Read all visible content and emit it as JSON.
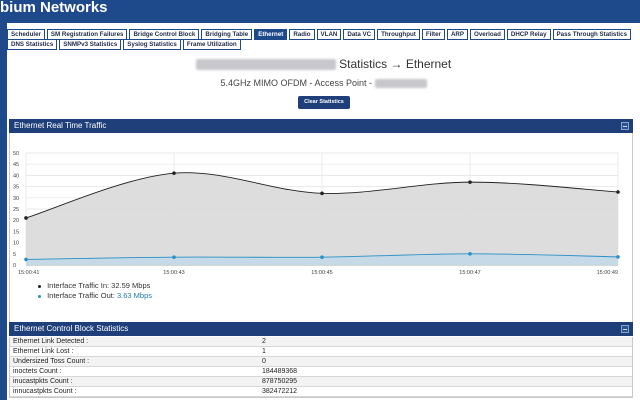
{
  "header": {
    "brand": "bium Networks"
  },
  "tabs_row1": [
    {
      "label": "Scheduler",
      "active": false
    },
    {
      "label": "SM Registration Failures",
      "active": false
    },
    {
      "label": "Bridge Control Block",
      "active": false
    },
    {
      "label": "Bridging Table",
      "active": false
    },
    {
      "label": "Ethernet",
      "active": true
    },
    {
      "label": "Radio",
      "active": false
    },
    {
      "label": "VLAN",
      "active": false
    },
    {
      "label": "Data VC",
      "active": false
    },
    {
      "label": "Throughput",
      "active": false
    },
    {
      "label": "Filter",
      "active": false
    },
    {
      "label": "ARP",
      "active": false
    },
    {
      "label": "Overload",
      "active": false
    },
    {
      "label": "DHCP Relay",
      "active": false
    },
    {
      "label": "Pass Through Statistics",
      "active": false
    }
  ],
  "tabs_row2": [
    {
      "label": "DNS Statistics",
      "active": false
    },
    {
      "label": "SNMPv3 Statistics",
      "active": false
    },
    {
      "label": "Syslog Statistics",
      "active": false
    },
    {
      "label": "Frame Utilization",
      "active": false
    }
  ],
  "page": {
    "title_suffix": "Statistics → Ethernet",
    "subtitle_prefix": "5.4GHz MIMO OFDM - Access Point -",
    "clear_button": "Clear Statistics"
  },
  "realtime_panel": {
    "title": "Ethernet Real Time Traffic",
    "legend_in_label": "Interface Traffic In:",
    "legend_in_value": "32.59 Mbps",
    "legend_out_label": "Interface Traffic Out:",
    "legend_out_value": "3.63 Mbps"
  },
  "control_panel": {
    "title": "Ethernet Control Block Statistics",
    "rows": [
      {
        "label": "Ethernet Link Detected :",
        "value": "2"
      },
      {
        "label": "Ethernet Link Lost :",
        "value": "1"
      },
      {
        "label": "Undersized Toss Count :",
        "value": "0"
      },
      {
        "label": "inoctets Count :",
        "value": "184489368"
      },
      {
        "label": "inucastpkts Count :",
        "value": "878750295"
      },
      {
        "label": "innucastpkts Count :",
        "value": "382472212"
      }
    ]
  },
  "colors": {
    "brand_blue": "#1e4a8c",
    "panel_header": "#1e3f7a",
    "series_in": "#222222",
    "series_in_fill": "#d9d9d9",
    "series_out": "#2a8fc4",
    "series_out_fill": "#c3d8e6"
  },
  "chart_data": {
    "type": "area",
    "x": [
      "15:00:41",
      "15:00:43",
      "15:00:45",
      "15:00:47",
      "15:00:49"
    ],
    "ylim": [
      0,
      50
    ],
    "yticks": [
      0,
      5,
      10,
      15,
      20,
      25,
      30,
      35,
      40,
      45,
      50
    ],
    "grid": true,
    "series": [
      {
        "name": "Interface Traffic In",
        "values": [
          21,
          41,
          32,
          37,
          32.59
        ]
      },
      {
        "name": "Interface Traffic Out",
        "values": [
          2.5,
          3.5,
          3.5,
          5,
          3.63
        ]
      }
    ]
  }
}
